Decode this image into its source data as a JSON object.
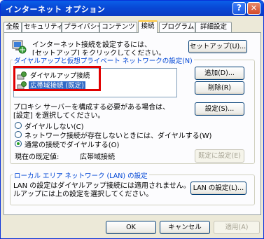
{
  "titlebar": {
    "title": "インターネット オプション",
    "help": "?",
    "close": "✕"
  },
  "tabs": [
    "全般",
    "セキュリティ",
    "プライバシー",
    "コンテンツ",
    "接続",
    "プログラム",
    "詳細設定"
  ],
  "setup": {
    "text1": "インターネット接続を設定するには、",
    "text2": "[セットアップ] をクリックしてください。",
    "button": "セットアップ(U)..."
  },
  "dialup_group": {
    "label": "ダイヤルアップと仮想プライベート ネットワークの設定(N)",
    "items": [
      {
        "label": "ダイヤルアップ接続",
        "selected": false
      },
      {
        "label": "広帯域接続 (既定)",
        "selected": true
      }
    ],
    "add_button": "追加(D)...",
    "remove_button": "削除(R)",
    "settings_button": "設定(S)...",
    "proxy_text1": "プロキシ サーバーを構成する必要がある場合は、",
    "proxy_text2": "[設定] を選択してください。",
    "radios": [
      {
        "label": "ダイヤルしない(C)",
        "checked": false
      },
      {
        "label": "ネットワーク接続が存在しないときには、ダイヤルする(W)",
        "checked": false
      },
      {
        "label": "通常の接続でダイヤルする(O)",
        "checked": true
      }
    ],
    "current_default_label": "現在の既定値:",
    "current_default_value": "広帯域接続",
    "set_default_button": "既定に設定(E)"
  },
  "lan_group": {
    "label": "ローカル エリア ネットワーク (LAN) の設定",
    "text1": "LAN の設定はダイヤルアップ接続には適用されません。ダイヤ",
    "text2": "ルアップには上の設定を選択してください。",
    "button": "LAN の設定(L)..."
  },
  "footer": {
    "ok": "OK",
    "cancel": "キャンセル",
    "apply": "適用(A)"
  },
  "colors": {
    "title_blue": "#0a5fe8",
    "group_label": "#0046d5",
    "highlight": "#e00000",
    "selection": "#316ac5"
  }
}
